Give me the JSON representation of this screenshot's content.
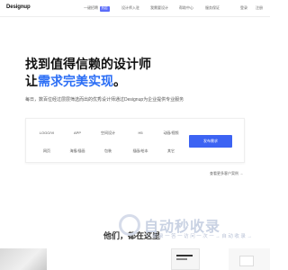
{
  "nav": {
    "logo": "Designup",
    "items": [
      {
        "label": "一键招聘",
        "badge": "热招"
      },
      {
        "label": "设计师入驻"
      },
      {
        "label": "我需要设计"
      },
      {
        "label": "帮助中心"
      },
      {
        "label": "服务保证"
      }
    ],
    "login": "登录",
    "register": "注册"
  },
  "hero": {
    "line1": "找到值得信赖的设计师",
    "line2_prefix": "让",
    "line2_highlight": "需求完美实现",
    "line2_suffix": "。",
    "subtitle": "每日，数百位经过层层筛选而出的优秀设计师通过Designup为企业提供专业服务"
  },
  "categories": {
    "row1": [
      "LOGO/VI",
      "APP",
      "空间设计",
      "H5",
      "动画/视频"
    ],
    "row2": [
      "网页",
      "海报/插画",
      "包装",
      "插画/绘本",
      "其它"
    ]
  },
  "cta_label": "发布需求",
  "more_link": "查看更多客户案例 →",
  "section_title": "他们，都在这里",
  "watermark": {
    "title": "自动秒收录",
    "subtitle": "一 收 录 一 答 一 访 问 一 次 一 → 自 动 收 录 →"
  }
}
